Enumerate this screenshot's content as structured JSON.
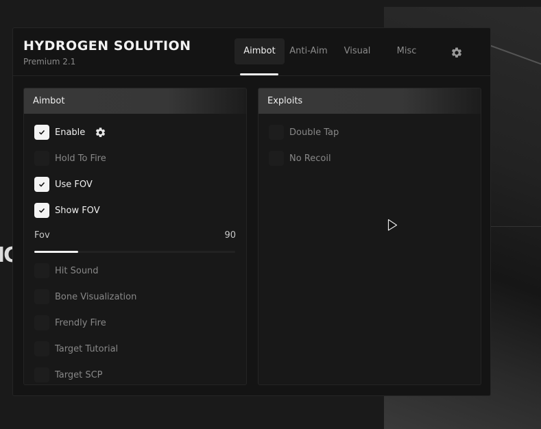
{
  "app": {
    "title": "HYDROGEN SOLUTION",
    "subtitle": "Premium 2.1"
  },
  "tabs": [
    {
      "label": "Aimbot",
      "active": true
    },
    {
      "label": "Anti-Aim",
      "active": false
    },
    {
      "label": "Visual",
      "active": false
    },
    {
      "label": "Misc",
      "active": false
    }
  ],
  "settings_icon": "gear-icon",
  "panels": {
    "aimbot": {
      "title": "Aimbot",
      "options": [
        {
          "label": "Enable",
          "checked": true
        },
        {
          "label": "Hold To Fire",
          "checked": false
        },
        {
          "label": "Use FOV",
          "checked": true
        },
        {
          "label": "Show FOV",
          "checked": true
        },
        {
          "label": "Hit Sound",
          "checked": false
        },
        {
          "label": "Bone Visualization",
          "checked": false
        },
        {
          "label": "Frendly Fire",
          "checked": false
        },
        {
          "label": "Target Tutorial",
          "checked": false
        },
        {
          "label": "Target SCP",
          "checked": false
        }
      ],
      "fov_slider": {
        "label": "Fov",
        "value": "90",
        "fill_fraction": 0.22
      }
    },
    "exploits": {
      "title": "Exploits",
      "options": [
        {
          "label": "Double Tap",
          "checked": false
        },
        {
          "label": "No Recoil",
          "checked": false
        }
      ]
    }
  },
  "colors": {
    "checked": "#f4f4f4",
    "unchecked": "#1d1d1d",
    "window": "#141414",
    "accent_text": "#f0f0f0"
  }
}
